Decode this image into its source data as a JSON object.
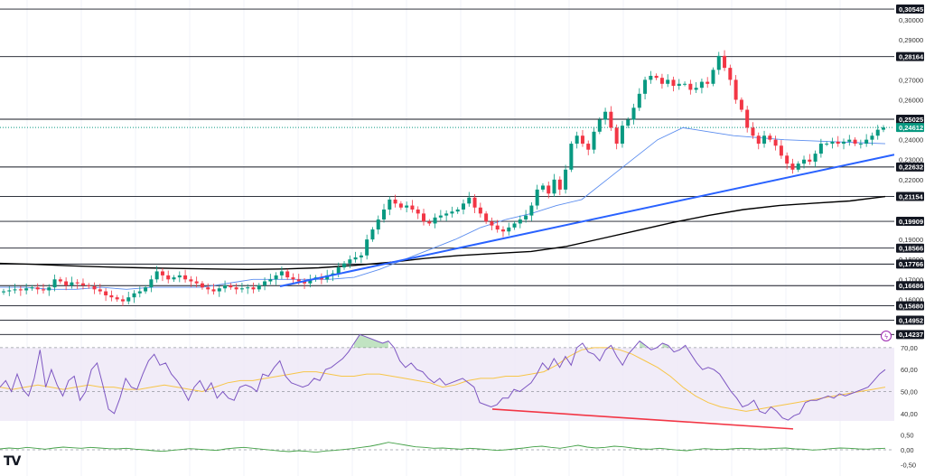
{
  "chart_data": [
    {
      "type": "candlestick",
      "title": "",
      "ylim": [
        0.138,
        0.31
      ],
      "y_ticks": [
        "0,30000",
        "0,29000",
        "0,27000",
        "0,26000",
        "0,24000",
        "0,23000",
        "0,22000",
        "0,19000",
        "0,18000",
        "0,17000",
        "0,16000"
      ],
      "horizontal_levels": [
        {
          "value": 0.30545,
          "label": "0,30545"
        },
        {
          "value": 0.28164,
          "label": "0,28164"
        },
        {
          "value": 0.25025,
          "label": "0,25025"
        },
        {
          "value": 0.22632,
          "label": "0,22632"
        },
        {
          "value": 0.21154,
          "label": "0,21154"
        },
        {
          "value": 0.19909,
          "label": "0,19909"
        },
        {
          "value": 0.18566,
          "label": "0,18566"
        },
        {
          "value": 0.17766,
          "label": "0,17766"
        },
        {
          "value": 0.16686,
          "label": "0,16686"
        },
        {
          "value": 0.1568,
          "label": "0,15680"
        },
        {
          "value": 0.14952,
          "label": "0,14952"
        },
        {
          "value": 0.14237,
          "label": "0,14237"
        }
      ],
      "last_price": {
        "value": 0.24612,
        "label": "0,24612",
        "color": "#089981"
      },
      "colors": {
        "up": "#089981",
        "down": "#f23645",
        "ma_short": "#5b8def",
        "ma_long": "#000000",
        "trendline": "#2962ff"
      },
      "series": [
        {
          "name": "price",
          "values": [
            0.164,
            0.1645,
            0.165,
            0.1645,
            0.1655,
            0.166,
            0.165,
            0.1645,
            0.166,
            0.17,
            0.169,
            0.167,
            0.1685,
            0.168,
            0.167,
            0.1665,
            0.165,
            0.164,
            0.162,
            0.161,
            0.16,
            0.159,
            0.161,
            0.163,
            0.164,
            0.166,
            0.17,
            0.174,
            0.172,
            0.17,
            0.171,
            0.172,
            0.17,
            0.169,
            0.168,
            0.166,
            0.165,
            0.164,
            0.1655,
            0.167,
            0.166,
            0.165,
            0.1655,
            0.166,
            0.165,
            0.167,
            0.169,
            0.17,
            0.172,
            0.174,
            0.171,
            0.17,
            0.169,
            0.168,
            0.17,
            0.171,
            0.17,
            0.172,
            0.173,
            0.176,
            0.178,
            0.18,
            0.181,
            0.182,
            0.19,
            0.195,
            0.2,
            0.205,
            0.21,
            0.208,
            0.206,
            0.207,
            0.205,
            0.203,
            0.199,
            0.198,
            0.201,
            0.202,
            0.203,
            0.204,
            0.205,
            0.208,
            0.211,
            0.206,
            0.203,
            0.199,
            0.197,
            0.195,
            0.194,
            0.196,
            0.198,
            0.2,
            0.202,
            0.207,
            0.215,
            0.217,
            0.213,
            0.22,
            0.215,
            0.225,
            0.238,
            0.242,
            0.238,
            0.235,
            0.244,
            0.25,
            0.254,
            0.246,
            0.238,
            0.247,
            0.25,
            0.256,
            0.263,
            0.27,
            0.272,
            0.271,
            0.268,
            0.27,
            0.267,
            0.268,
            0.268,
            0.265,
            0.266,
            0.269,
            0.268,
            0.275,
            0.282,
            0.276,
            0.27,
            0.26,
            0.255,
            0.246,
            0.242,
            0.238,
            0.242,
            0.24,
            0.237,
            0.232,
            0.228,
            0.225,
            0.228,
            0.23,
            0.229,
            0.233,
            0.238,
            0.238,
            0.239,
            0.238,
            0.239,
            0.24,
            0.238,
            0.238,
            0.24,
            0.242,
            0.245,
            0.2461
          ]
        },
        {
          "name": "ma_short",
          "values": [
            0.166,
            0.166,
            0.165,
            0.165,
            0.166,
            0.165,
            0.166,
            0.166,
            0.166,
            0.168,
            0.17,
            0.17,
            0.17,
            0.17,
            0.171,
            0.175,
            0.18,
            0.185,
            0.19,
            0.196,
            0.2,
            0.203,
            0.207,
            0.21,
            0.22,
            0.23,
            0.24,
            0.246,
            0.244,
            0.242,
            0.241,
            0.24,
            0.2395,
            0.239,
            0.2385,
            0.238
          ]
        },
        {
          "name": "ma_long",
          "values": [
            0.178,
            0.1775,
            0.1768,
            0.1762,
            0.1758,
            0.1755,
            0.1752,
            0.175,
            0.1752,
            0.1758,
            0.177,
            0.1785,
            0.1805,
            0.182,
            0.183,
            0.184,
            0.1865,
            0.1905,
            0.1945,
            0.1985,
            0.202,
            0.205,
            0.207,
            0.2082,
            0.2093,
            0.2115
          ]
        }
      ],
      "trendline": {
        "from": 0.1665,
        "to": 0.2325
      }
    },
    {
      "type": "line",
      "title": "",
      "ylim": [
        35,
        72
      ],
      "y_ticks": [
        "70,00",
        "60,00",
        "50,00",
        "40,00"
      ],
      "bands": [
        30,
        50,
        70
      ],
      "series": [
        {
          "name": "rsi",
          "values": [
            52,
            55,
            50,
            58,
            51,
            48,
            56,
            69,
            52,
            60,
            53,
            48,
            55,
            57,
            46,
            50,
            60,
            63,
            53,
            42,
            40,
            47,
            56,
            52,
            51,
            58,
            64,
            67,
            62,
            63,
            58,
            55,
            51,
            46,
            52,
            55,
            50,
            54,
            47,
            50,
            47,
            46,
            52,
            53,
            52,
            50,
            58,
            57,
            61,
            64,
            57,
            54,
            53,
            52,
            53,
            56,
            55,
            60,
            61,
            63,
            65,
            68,
            72,
            76,
            75,
            74,
            73,
            72,
            73,
            70,
            64,
            61,
            63,
            60,
            59,
            56,
            54,
            56,
            53,
            54,
            55,
            56,
            54,
            52,
            45,
            44,
            43,
            44,
            47,
            47,
            51,
            50,
            52,
            54,
            58,
            63,
            60,
            65,
            61,
            66,
            62,
            70,
            72,
            68,
            67,
            64,
            69,
            71,
            66,
            62,
            67,
            70,
            73,
            71,
            69,
            70,
            72,
            71,
            68,
            69,
            71,
            67,
            63,
            60,
            61,
            60,
            58,
            54,
            50,
            47,
            43,
            44,
            46,
            41,
            40,
            43,
            41,
            38,
            37,
            39,
            40,
            45,
            46,
            46,
            47,
            48,
            47,
            49,
            48,
            49,
            50,
            51,
            52,
            55,
            58,
            60
          ]
        },
        {
          "name": "rsi_ma",
          "values": [
            52,
            51,
            52,
            53,
            52,
            51,
            52,
            53,
            52,
            52,
            51,
            51,
            52,
            53,
            52,
            51,
            50,
            52,
            54,
            55,
            55,
            56,
            57,
            58,
            59,
            59,
            58,
            57,
            57,
            58,
            58,
            57,
            56,
            55,
            54,
            52,
            53,
            55,
            56,
            56,
            57,
            57,
            58,
            59,
            62,
            66,
            69,
            70,
            70,
            69,
            67,
            64,
            61,
            57,
            52,
            48,
            45,
            43,
            42,
            41,
            42,
            43,
            44,
            45,
            46,
            47,
            48,
            49,
            50,
            51,
            52
          ]
        },
        {
          "name": "divergence_line",
          "values": [
            42,
            33
          ]
        }
      ]
    },
    {
      "type": "line",
      "title": "",
      "ylim": [
        -0.6,
        0.6
      ],
      "y_ticks": [
        "0,50",
        "0,00",
        "-0,50"
      ],
      "series": [
        {
          "name": "oscillator",
          "values": [
            0.03,
            0.06,
            0.04,
            0.08,
            0.05,
            0.02,
            0.06,
            0.09,
            0.07,
            0.05,
            0.08,
            0.06,
            0.04,
            0.03,
            0.05,
            0.02,
            0.0,
            -0.03,
            -0.05,
            -0.02,
            0.01,
            0.04,
            0.02,
            0.0,
            -0.02,
            0.03,
            0.06,
            0.08,
            0.05,
            0.02,
            -0.01,
            -0.04,
            -0.06,
            -0.03,
            -0.05,
            -0.08,
            -0.04,
            -0.02,
            0.01,
            0.04,
            0.08,
            0.12,
            0.18,
            0.25,
            0.2,
            0.15,
            0.1,
            0.08,
            0.05,
            0.06,
            0.04,
            0.02,
            0.05,
            0.03,
            0.01,
            -0.02,
            0.0,
            0.03,
            0.06,
            0.1,
            0.12,
            0.08,
            0.05,
            0.1,
            0.15,
            0.09,
            0.06,
            0.08,
            0.12,
            0.1,
            0.06,
            0.03,
            0.02,
            0.05,
            0.02,
            -0.01,
            -0.03,
            0.01,
            0.04,
            0.02,
            0.01,
            0.03,
            0.05,
            0.04,
            0.02,
            0.03,
            0.05,
            0.06,
            0.03,
            0.02,
            -0.01,
            0.01,
            0.04,
            0.06,
            0.05,
            0.03,
            0.02,
            0.04,
            0.05
          ]
        }
      ]
    }
  ],
  "logo": {
    "text": "TV"
  },
  "icons": {
    "flash": "flash-circle-icon"
  }
}
